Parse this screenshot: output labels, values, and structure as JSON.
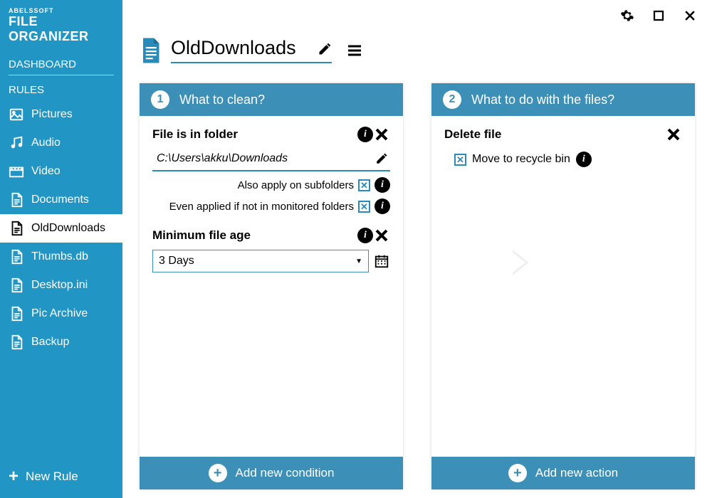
{
  "brand": {
    "top": "ABELSSOFT",
    "bottom": "FILE ORGANIZER"
  },
  "nav": {
    "dashboard": "DASHBOARD",
    "rules_heading": "RULES",
    "items": [
      {
        "label": "Pictures",
        "icon": "image"
      },
      {
        "label": "Audio",
        "icon": "music"
      },
      {
        "label": "Video",
        "icon": "clapper"
      },
      {
        "label": "Documents",
        "icon": "doc"
      },
      {
        "label": "OldDownloads",
        "icon": "doc",
        "active": true
      },
      {
        "label": "Thumbs.db",
        "icon": "doc"
      },
      {
        "label": "Desktop.ini",
        "icon": "doc"
      },
      {
        "label": "Pic Archive",
        "icon": "doc"
      },
      {
        "label": "Backup",
        "icon": "doc"
      }
    ],
    "new_rule": "New Rule"
  },
  "page": {
    "title": "OldDownloads"
  },
  "panel1": {
    "step": "1",
    "heading": "What to clean?",
    "cond_folder": {
      "title": "File is in folder",
      "path": "C:\\Users\\akku\\Downloads",
      "opt_subfolders": "Also apply on subfolders",
      "opt_nonmonitored": "Even applied if not in monitored folders"
    },
    "cond_age": {
      "title": "Minimum file age",
      "value": "3 Days"
    },
    "add": "Add new condition"
  },
  "panel2": {
    "step": "2",
    "heading": "What to do with the files?",
    "action": {
      "title": "Delete file",
      "opt_recycle": "Move to recycle bin"
    },
    "add": "Add new action"
  }
}
